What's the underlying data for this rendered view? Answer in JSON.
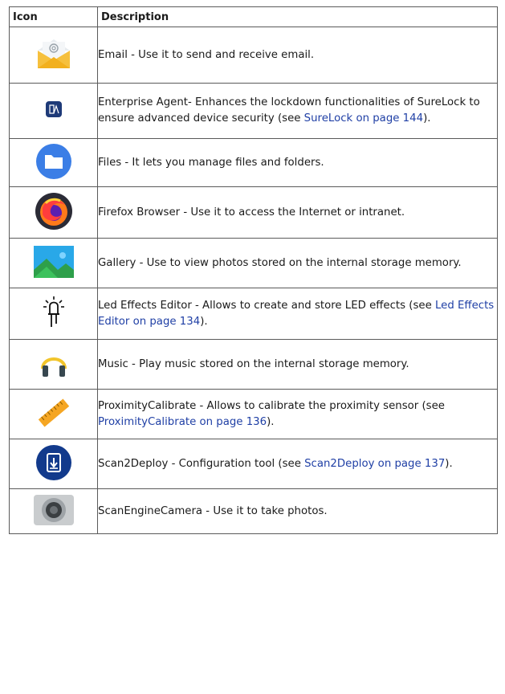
{
  "table": {
    "headers": {
      "icon": "Icon",
      "description": "Description"
    },
    "rows": [
      {
        "icon": "email-icon",
        "text": "Email - Use it to send and receive email."
      },
      {
        "icon": "enterprise-agent-icon",
        "text": "Enterprise Agent- Enhances the lockdown functionalities of SureLock to ensure advanced device security (see ",
        "link": "SureLock on page 144",
        "suffix": ")."
      },
      {
        "icon": "files-icon",
        "text": "Files - It lets you manage files and folders."
      },
      {
        "icon": "firefox-icon",
        "text": "Firefox Browser - Use it to access the Internet or intranet."
      },
      {
        "icon": "gallery-icon",
        "text": "Gallery - Use to view photos stored on the internal storage memory."
      },
      {
        "icon": "led-effects-icon",
        "text": "Led Effects Editor - Allows to create and store LED effects (see ",
        "link": "Led Effects Editor on page 134",
        "suffix": ")."
      },
      {
        "icon": "music-icon",
        "text": "Music - Play music stored on the internal storage memory."
      },
      {
        "icon": "ruler-icon",
        "text": "ProximityCalibrate - Allows to calibrate the proximity sensor (see ",
        "link": "ProximityCalibrate on page 136",
        "suffix": ")."
      },
      {
        "icon": "scan2deploy-icon",
        "text": "Scan2Deploy - Configuration tool (see ",
        "link": "Scan2Deploy on page 137",
        "suffix": ")."
      },
      {
        "icon": "camera-icon",
        "text": "ScanEngineCamera - Use it to take photos."
      }
    ]
  }
}
